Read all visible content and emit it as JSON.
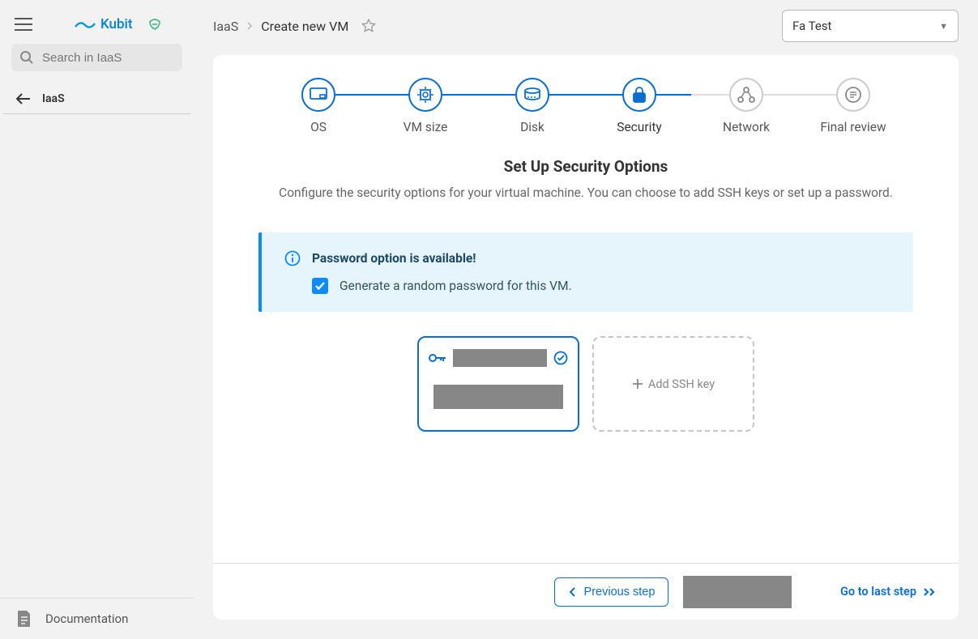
{
  "sidebar": {
    "logo_text": "Kubit",
    "search_placeholder": "Search in IaaS",
    "nav_item_label": "IaaS",
    "footer_label": "Documentation"
  },
  "header": {
    "breadcrumb_root": "IaaS",
    "breadcrumb_current": "Create new VM",
    "project_selected": "Fa Test"
  },
  "stepper": {
    "steps": [
      {
        "label": "OS"
      },
      {
        "label": "VM size"
      },
      {
        "label": "Disk"
      },
      {
        "label": "Security"
      },
      {
        "label": "Network"
      },
      {
        "label": "Final review"
      }
    ]
  },
  "content": {
    "title": "Set Up Security Options",
    "description": "Configure the security options for your virtual machine. You can choose to add SSH keys or set up a password.",
    "info_title": "Password option is available!",
    "checkbox_label": "Generate a random password for this VM.",
    "add_key_label": "Add SSH key"
  },
  "footer": {
    "prev_label": "Previous step",
    "last_label": "Go to last step"
  }
}
